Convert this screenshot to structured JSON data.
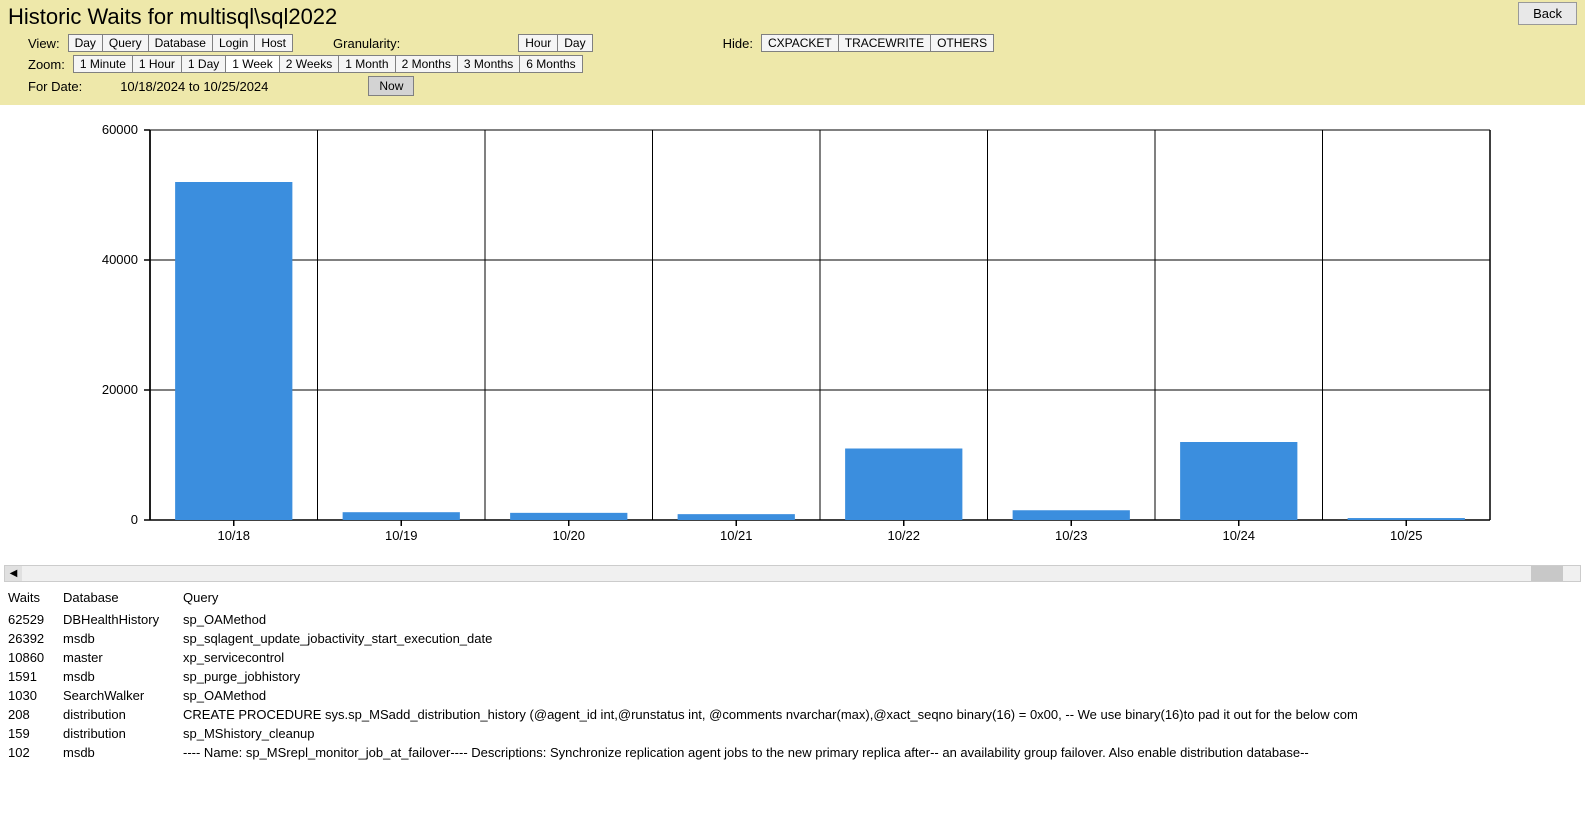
{
  "title": "Historic Waits for multisql\\sql2022",
  "back_label": "Back",
  "controls": {
    "view_label": "View:",
    "view_buttons": [
      "Day",
      "Query",
      "Database",
      "Login",
      "Host"
    ],
    "granularity_label": "Granularity:",
    "granularity_buttons": [
      "Hour",
      "Day"
    ],
    "hide_label": "Hide:",
    "hide_buttons": [
      "CXPACKET",
      "TRACEWRITE",
      "OTHERS"
    ],
    "zoom_label": "Zoom:",
    "zoom_buttons": [
      "1 Minute",
      "1 Hour",
      "1 Day",
      "1 Week",
      "2 Weeks",
      "1 Month",
      "2 Months",
      "3 Months",
      "6 Months"
    ],
    "zoom_active": "1 Week",
    "for_date_label": "For Date:",
    "date_range": "10/18/2024 to 10/25/2024",
    "now_label": "Now"
  },
  "chart_data": {
    "type": "bar",
    "categories": [
      "10/18",
      "10/19",
      "10/20",
      "10/21",
      "10/22",
      "10/23",
      "10/24",
      "10/25"
    ],
    "values": [
      52000,
      1200,
      1100,
      900,
      11000,
      1500,
      12000,
      300
    ],
    "ylim": [
      0,
      60000
    ],
    "yticks": [
      0,
      20000,
      40000,
      60000
    ],
    "title": "",
    "xlabel": "",
    "ylabel": ""
  },
  "table": {
    "headers": [
      "Waits",
      "Database",
      "Query"
    ],
    "rows": [
      {
        "waits": "62529",
        "database": "DBHealthHistory",
        "query": "sp_OAMethod"
      },
      {
        "waits": "26392",
        "database": "msdb",
        "query": "sp_sqlagent_update_jobactivity_start_execution_date"
      },
      {
        "waits": "10860",
        "database": "master",
        "query": "xp_servicecontrol"
      },
      {
        "waits": "1591",
        "database": "msdb",
        "query": "sp_purge_jobhistory"
      },
      {
        "waits": "1030",
        "database": "SearchWalker",
        "query": "sp_OAMethod"
      },
      {
        "waits": "208",
        "database": "distribution",
        "query": "CREATE PROCEDURE sys.sp_MSadd_distribution_history (@agent_id int,@runstatus int, @comments nvarchar(max),@xact_seqno binary(16) = 0x00,     -- We use binary(16)to pad it out for the below com"
      },
      {
        "waits": "159",
        "database": "distribution",
        "query": "sp_MShistory_cleanup"
      },
      {
        "waits": "102",
        "database": "msdb",
        "query": "---- Name: sp_MSrepl_monitor_job_at_failover---- Descriptions: Synchronize replication agent jobs to the new primary replica after--         an availability group failover. Also enable distribution database--"
      }
    ]
  }
}
